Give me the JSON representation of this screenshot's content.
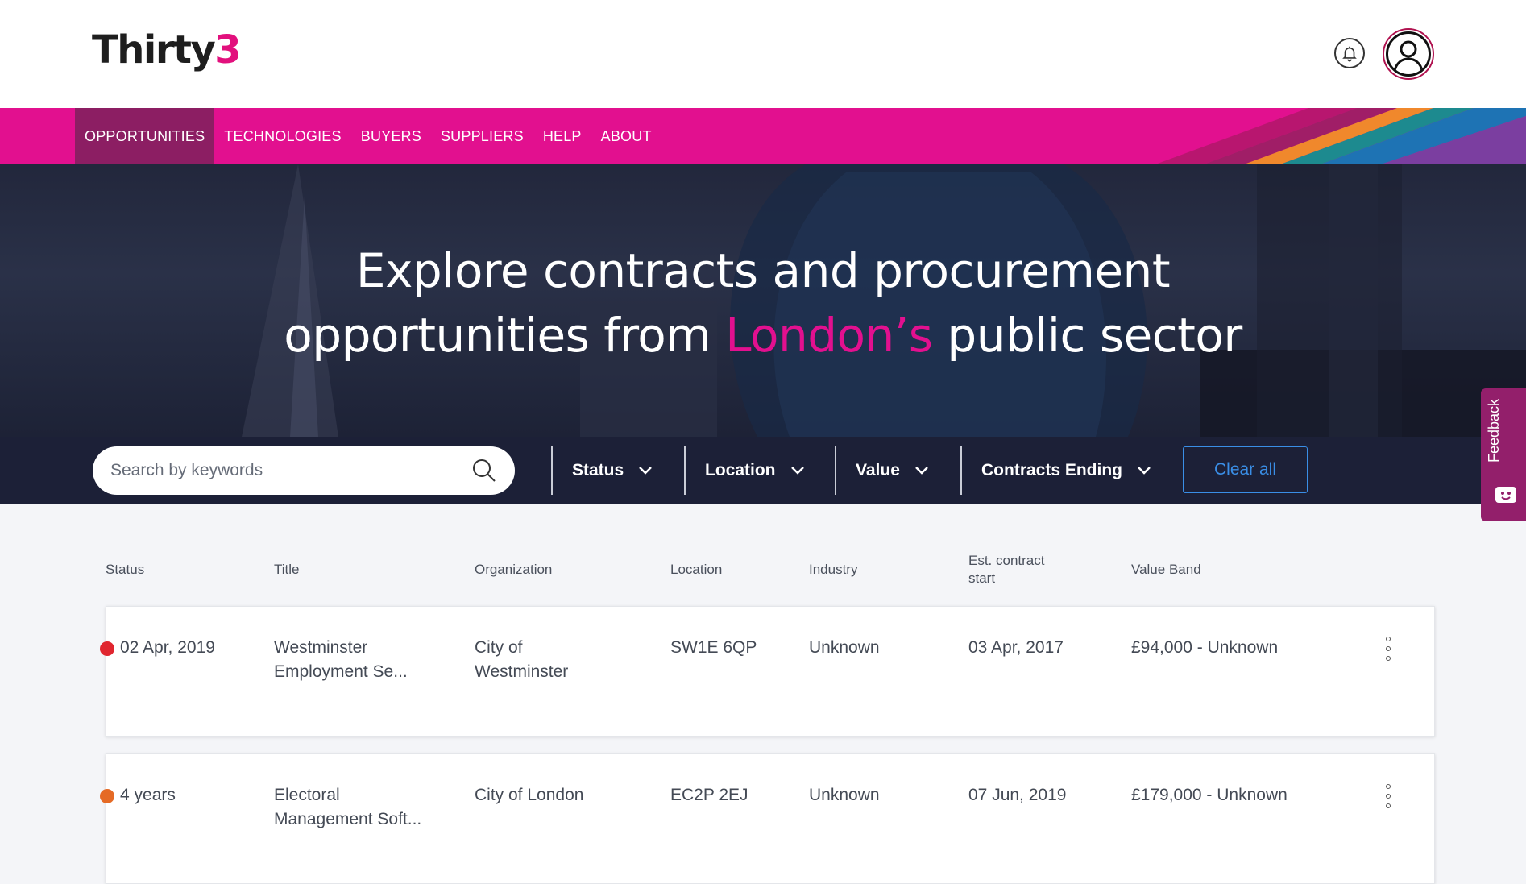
{
  "loading": {
    "progress": 0.17
  },
  "brand": {
    "logo_text": "Thirty",
    "logo_number": "3"
  },
  "nav": {
    "items": [
      {
        "label": "OPPORTUNITIES",
        "active": true
      },
      {
        "label": "TECHNOLOGIES"
      },
      {
        "label": "BUYERS"
      },
      {
        "label": "SUPPLIERS"
      },
      {
        "label": "HELP"
      },
      {
        "label": "ABOUT"
      }
    ]
  },
  "hero": {
    "line1": "Explore contracts and procurement",
    "line2_before": "opportunities from ",
    "line2_accent": "London’s",
    "line2_after": " public sector"
  },
  "search": {
    "placeholder": "Search by keywords"
  },
  "filters": {
    "status": "Status",
    "location": "Location",
    "value": "Value",
    "contracts_ending": "Contracts Ending",
    "clear_all": "Clear all"
  },
  "feedback": {
    "label": "Feedback"
  },
  "table": {
    "columns": {
      "status": "Status",
      "title": "Title",
      "organization": "Organization",
      "location": "Location",
      "industry": "Industry",
      "est_start_line1": "Est. contract",
      "est_start_line2": "start",
      "value_band": "Value Band"
    },
    "rows": [
      {
        "status_color": "#e0262f",
        "status": "02 Apr, 2019",
        "title_l1": "Westminster",
        "title_l2": "Employment Se...",
        "org_l1": "City of",
        "org_l2": "Westminster",
        "location": "SW1E 6QP",
        "industry": "Unknown",
        "est_start": "03 Apr, 2017",
        "value_band": "£94,000 - Unknown"
      },
      {
        "status_color": "#e56a25",
        "status": "4 years",
        "title_l1": "Electoral",
        "title_l2": "Management Soft...",
        "org_l1": "City of London",
        "org_l2": "",
        "location": "EC2P 2EJ",
        "industry": "Unknown",
        "est_start": "07 Jun, 2019",
        "value_band": "£179,000 - Unknown"
      }
    ]
  },
  "colors": {
    "brand_pink": "#e2108f",
    "nav_active": "#8c1e63",
    "hero_dark": "#1c2037",
    "accent_blue": "#3a8ee6",
    "status_red": "#e0262f",
    "status_orange": "#e56a25"
  },
  "icons": {
    "notification": "bell-icon",
    "account": "user-avatar-icon",
    "search": "search-icon",
    "dropdown": "chevron-down-icon",
    "row_menu": "kebab-menu-icon",
    "feedback": "feedback-face-icon"
  }
}
